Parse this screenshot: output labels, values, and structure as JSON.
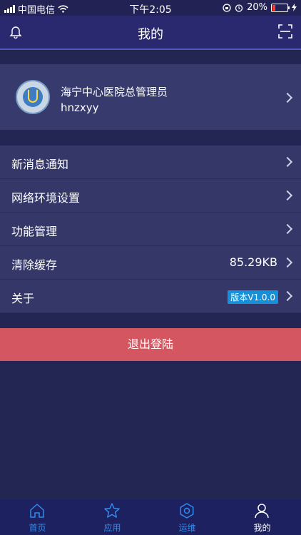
{
  "status_bar": {
    "carrier": "中国电信",
    "time": "下午2:05",
    "battery": "20%",
    "icons": [
      "signal-icon",
      "wifi-icon",
      "orientation-lock-icon",
      "alarm-icon",
      "battery-icon",
      "charging-icon"
    ]
  },
  "nav": {
    "title": "我的",
    "icons": [
      "bell-icon",
      "scan-icon"
    ]
  },
  "profile": {
    "name": "海宁中心医院总管理员",
    "account": "hnzxyy",
    "icon": "hospital-logo-avatar"
  },
  "menu": {
    "items": [
      {
        "label": "新消息通知"
      },
      {
        "label": "网络环境设置"
      },
      {
        "label": "功能管理"
      },
      {
        "label": "清除缓存",
        "value": "85.29KB"
      },
      {
        "label": "关于",
        "badge": "版本V1.0.0"
      }
    ]
  },
  "logout": {
    "label": "退出登陆"
  },
  "tabs": {
    "items": [
      {
        "label": "首页",
        "icon": "home-icon"
      },
      {
        "label": "应用",
        "icon": "star-icon"
      },
      {
        "label": "运维",
        "icon": "gear-icon"
      },
      {
        "label": "我的",
        "icon": "user-icon"
      }
    ],
    "active_index": 3
  },
  "colors": {
    "background": "#232552",
    "nav": "#2a2970",
    "card": "#343768",
    "logout": "#d35660",
    "tab_active": "#ffffff",
    "tab_inactive": "#2f8cf0",
    "badge": "#1690d8",
    "battery_low": "#ff3b30"
  }
}
